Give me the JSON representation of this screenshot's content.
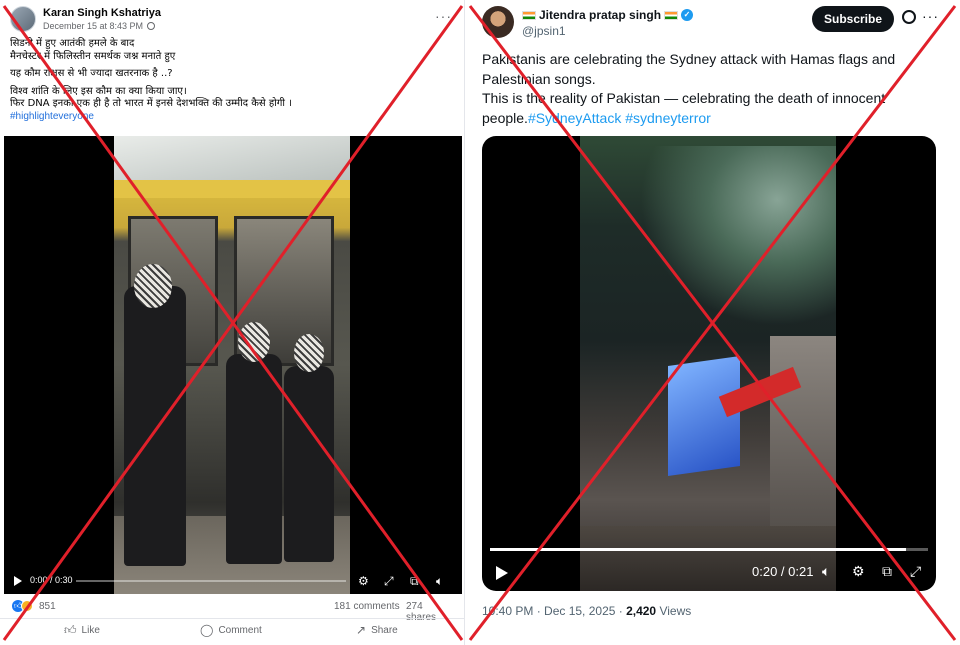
{
  "facebook_post": {
    "author": "Karan Singh Kshatriya",
    "timestamp": "December 15 at 8:43 PM",
    "more_label": "···",
    "text_lines": [
      "सिडनी में हुए आतंकी हमले के बाद",
      "मैनचेस्टर में फिलिस्तीन समर्थक जश्न मनाते हुए",
      "यह कौम राक्षस से भी ज्यादा खतरनाक है ..?",
      "विश्व शांति के लिए इस कौम का क्या किया जाए।",
      "फिर DNA इनका एक ही है तो भारत में इनसे देशभक्ति की उम्मीद कैसे होगी ।"
    ],
    "hashtag": "#highlighteveryone",
    "video": {
      "time": "0:00 / 0:30"
    },
    "reactions_count": "851",
    "comments": "181 comments",
    "shares": "274 shares",
    "actions": {
      "like": "Like",
      "comment": "Comment",
      "share": "Share"
    },
    "icons": [
      "globe-icon",
      "play-icon",
      "gear-icon",
      "fullscreen-icon",
      "volume-icon",
      "like-icon",
      "comment-icon",
      "share-icon"
    ]
  },
  "x_post": {
    "display_name": "Jitendra pratap singh",
    "handle": "@jpsin1",
    "subscribe_label": "Subscribe",
    "more_label": "···",
    "text_line1": "Pakistanis are celebrating the Sydney attack with Hamas flags and Palestinian songs.",
    "text_line2": "This is the reality of Pakistan — celebrating the death of innocent people.",
    "hashtags": [
      "#SydneyAttack",
      "#sydneyterror"
    ],
    "video": {
      "time": "0:20 / 0:21",
      "progress": 0.95
    },
    "timestamp": "10:40 PM · Dec 15, 2025 · ",
    "views_count": "2,420",
    "views_label": " Views",
    "icons": [
      "flag-icon",
      "verified-icon",
      "grok-icon",
      "play-icon",
      "volume-icon",
      "gear-icon",
      "pip-icon",
      "fullscreen-icon"
    ]
  },
  "overlay": {
    "cross_color": "#e0202a"
  }
}
